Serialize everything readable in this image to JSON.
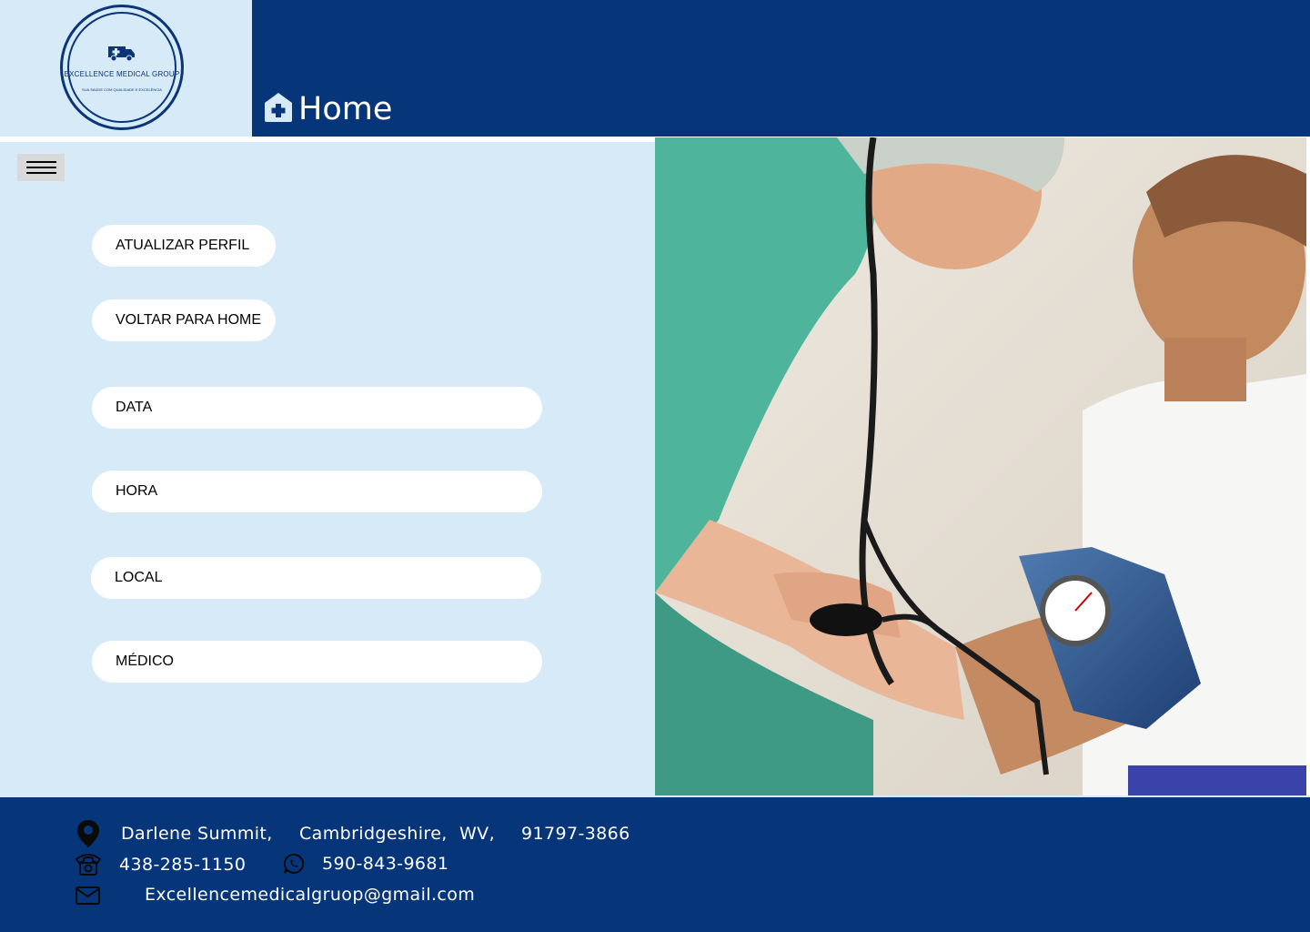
{
  "brand": {
    "name": "EXCELLENCE MEDICAL GROUP",
    "tagline": "SUA SAÚDE COM QUALIDADE E EXCELÊNCIA",
    "logo_icon": "ambulance-icon"
  },
  "header": {
    "title": "Home",
    "icon": "home-medical-icon"
  },
  "menu": {
    "icon": "hamburger-icon"
  },
  "actions": {
    "update_profile": "ATUALIZAR PERFIL",
    "back_home": "VOLTAR PARA HOME"
  },
  "fields": {
    "date": "DATA",
    "time": "HORA",
    "location": "LOCAL",
    "doctor": "MÉDICO"
  },
  "photo": {
    "icon": "doctor-measuring-blood-pressure-photo"
  },
  "footer": {
    "address": {
      "street": "Darlene Summit,",
      "county": "Cambridgeshire,",
      "state": "WV,",
      "zip": "91797-3866"
    },
    "phone": "438-285-1150",
    "whatsapp": "590-843-9681",
    "email": "Excellencemedicalgruop@gmail.com"
  },
  "colors": {
    "navy": "#06357a",
    "light_blue": "#d6eaf8",
    "white": "#ffffff"
  }
}
